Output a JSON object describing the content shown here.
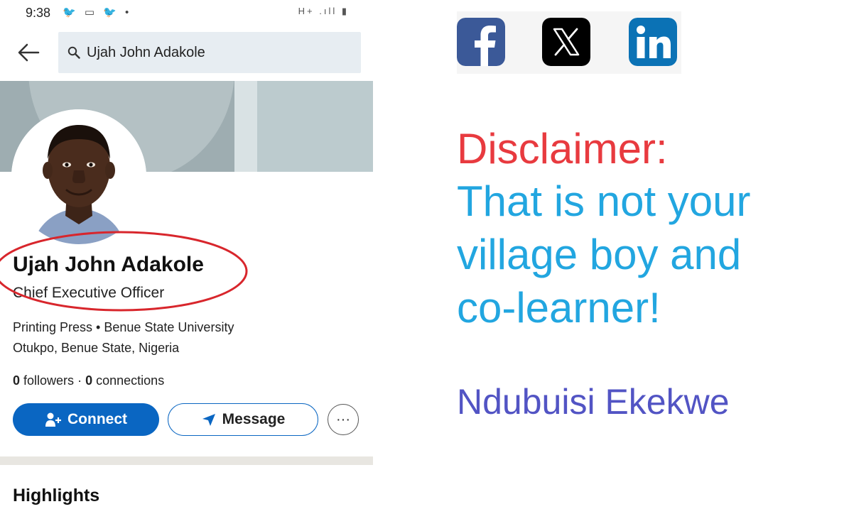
{
  "status_bar": {
    "time": "9:38",
    "left_icons": "🐦 ▭ 🐦 •",
    "right_icons": "H+ .ıll ▮"
  },
  "search": {
    "query": "Ujah John Adakole"
  },
  "profile": {
    "name": "Ujah John Adakole",
    "headline": "Chief Executive Officer",
    "company_school": "Printing Press • Benue State University",
    "location": "Otukpo, Benue State, Nigeria",
    "followers_count": "0",
    "followers_label": "followers",
    "separator": "·",
    "connections_count": "0",
    "connections_label": "connections"
  },
  "actions": {
    "connect": "Connect",
    "message": "Message",
    "more": "···"
  },
  "sections": {
    "highlights": "Highlights"
  },
  "social_icons": [
    "facebook-icon",
    "x-icon",
    "linkedin-icon"
  ],
  "overlay": {
    "disclaimer": "Disclaimer:",
    "statement_line1": "That is not your",
    "statement_line2": "village boy and",
    "statement_line3": "co-learner!",
    "author": "Ndubuisi Ekekwe"
  },
  "colors": {
    "linkedin_blue": "#0a66c2",
    "disclaimer_red": "#e83a3f",
    "statement_blue": "#22a6e0",
    "author_purple": "#5254c4",
    "annotation_red": "#d8262c"
  }
}
